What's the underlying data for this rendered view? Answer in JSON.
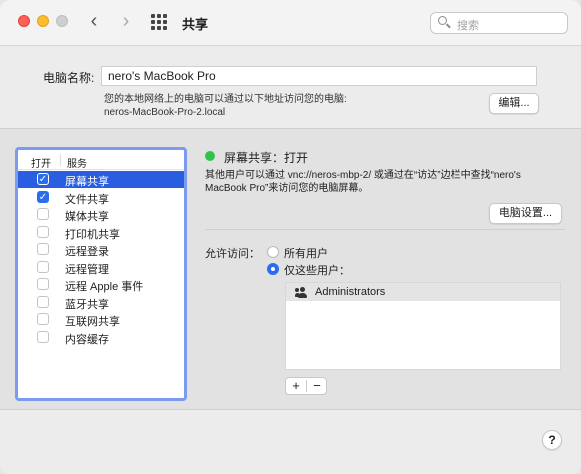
{
  "window": {
    "title": "共享"
  },
  "search": {
    "placeholder": "搜索"
  },
  "nav": {
    "back": "‹",
    "forward": "›"
  },
  "computer_name": {
    "label": "电脑名称:",
    "value": "nero's MacBook Pro",
    "desc_line1": "您的本地网络上的电脑可以通过以下地址访问您的电脑:",
    "desc_line2": "neros-MacBook-Pro-2.local",
    "edit_button": "编辑..."
  },
  "services": {
    "col_on": "打开",
    "col_service": "服务",
    "items": [
      {
        "label": "屏幕共享",
        "checked": true,
        "selected": true
      },
      {
        "label": "文件共享",
        "checked": true,
        "selected": false
      },
      {
        "label": "媒体共享",
        "checked": false,
        "selected": false
      },
      {
        "label": "打印机共享",
        "checked": false,
        "selected": false
      },
      {
        "label": "远程登录",
        "checked": false,
        "selected": false
      },
      {
        "label": "远程管理",
        "checked": false,
        "selected": false
      },
      {
        "label": "远程 Apple 事件",
        "checked": false,
        "selected": false
      },
      {
        "label": "蓝牙共享",
        "checked": false,
        "selected": false
      },
      {
        "label": "互联网共享",
        "checked": false,
        "selected": false
      },
      {
        "label": "内容缓存",
        "checked": false,
        "selected": false
      }
    ]
  },
  "detail": {
    "status": "屏幕共享：打开",
    "status_color": "#2ec44a",
    "info_line1": "其他用户可以通过 vnc://neros-mbp-2/ 或通过在“访达”边栏中查找“nero's",
    "info_line2": "MacBook Pro”来访问您的电脑屏幕。",
    "settings_button": "电脑设置...",
    "allow_label": "允许访问：",
    "radio_all": "所有用户",
    "radio_only": "仅这些用户：",
    "users": [
      "Administrators"
    ],
    "add": "+",
    "remove": "−"
  },
  "help": "?"
}
